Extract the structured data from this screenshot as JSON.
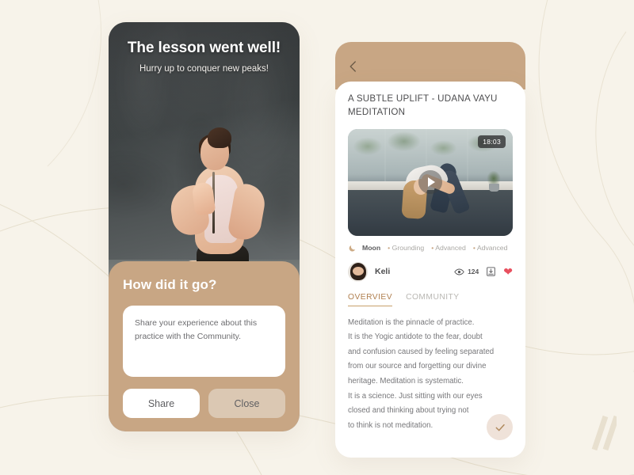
{
  "theme": {
    "background": "#f7f3ea",
    "tan": "#c8a684",
    "tan_light": "#dbc8b3",
    "accent_brown": "#b07f4f",
    "heart_red": "#e8505f",
    "text_dark": "#4d4d4f",
    "text_muted": "#77777a"
  },
  "left_screen": {
    "name": "lesson-complete-screen",
    "hero": {
      "title": "The lesson went well!",
      "subtitle": "Hurry up to conquer new peaks!",
      "image_alt": "woman meditating in lotus pose on red yoga mat"
    },
    "sheet": {
      "title": "How did it go?",
      "textarea_placeholder": "Share your experience about this practice with the Community.",
      "textarea_value": "",
      "share_label": "Share",
      "close_label": "Close"
    }
  },
  "right_screen": {
    "name": "meditation-detail-screen",
    "header": {
      "back_icon": "chevron-left-icon"
    },
    "title": "A SUBTLE UPLIFT - UDANA VAYU MEDITATION",
    "video": {
      "duration_badge": "18:03",
      "play_icon": "play-icon",
      "image_alt": "woman in wide-legged forward bend yoga pose indoors"
    },
    "tags": {
      "icon": "moon-icon",
      "primary": "Moon",
      "items": [
        "Grounding",
        "Advanced",
        "Advanced"
      ]
    },
    "author": {
      "avatar_icon": "avatar",
      "name": "Keli",
      "views_icon": "eye-icon",
      "views_count": "124",
      "download_icon": "download-icon",
      "like_icon": "heart-icon"
    },
    "tabs": [
      {
        "label": "OVERVIEV",
        "active": true
      },
      {
        "label": "COMMUNITY",
        "active": false
      }
    ],
    "description": "Meditation is the pinnacle of practice.\nIt is the Yogic antidote to the fear, doubt\nand confusion caused by feeling separated\nfrom our source and forgetting our divine\nheritage. Meditation is systematic.\nIt is a science. Just sitting with our eyes\nclosed and thinking about trying not\nto think is not meditation.",
    "fab": {
      "icon": "check-icon"
    }
  },
  "decoration": {
    "corner_mark": "double-slash-mark"
  }
}
